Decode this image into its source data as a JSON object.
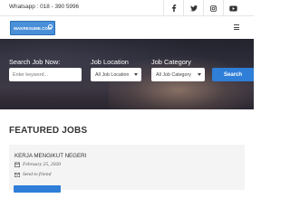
{
  "topbar": {
    "phone": "Whatsapp : 018 - 390 5996",
    "social": [
      "facebook-icon",
      "twitter-icon",
      "instagram-icon",
      "youtube-icon"
    ]
  },
  "header": {
    "logo_text": "MAKRESUME.COM"
  },
  "hero": {
    "search_label": "Search Job Now:",
    "search_placeholder": "Enter keyword...",
    "location_label": "Job Location",
    "location_value": "All Job Location",
    "category_label": "Job Category",
    "category_value": "All Job Category",
    "search_button": "Search"
  },
  "featured": {
    "heading": "FEATURED JOBS",
    "jobs": [
      {
        "title": "KERJA MENGIKUT NEGERI",
        "date": "February 25, 2020",
        "send": "Send to friend"
      }
    ]
  },
  "colors": {
    "accent": "#2f7ed8",
    "logo": "#4a90d9",
    "hero_dark": "#2d2d3a"
  }
}
